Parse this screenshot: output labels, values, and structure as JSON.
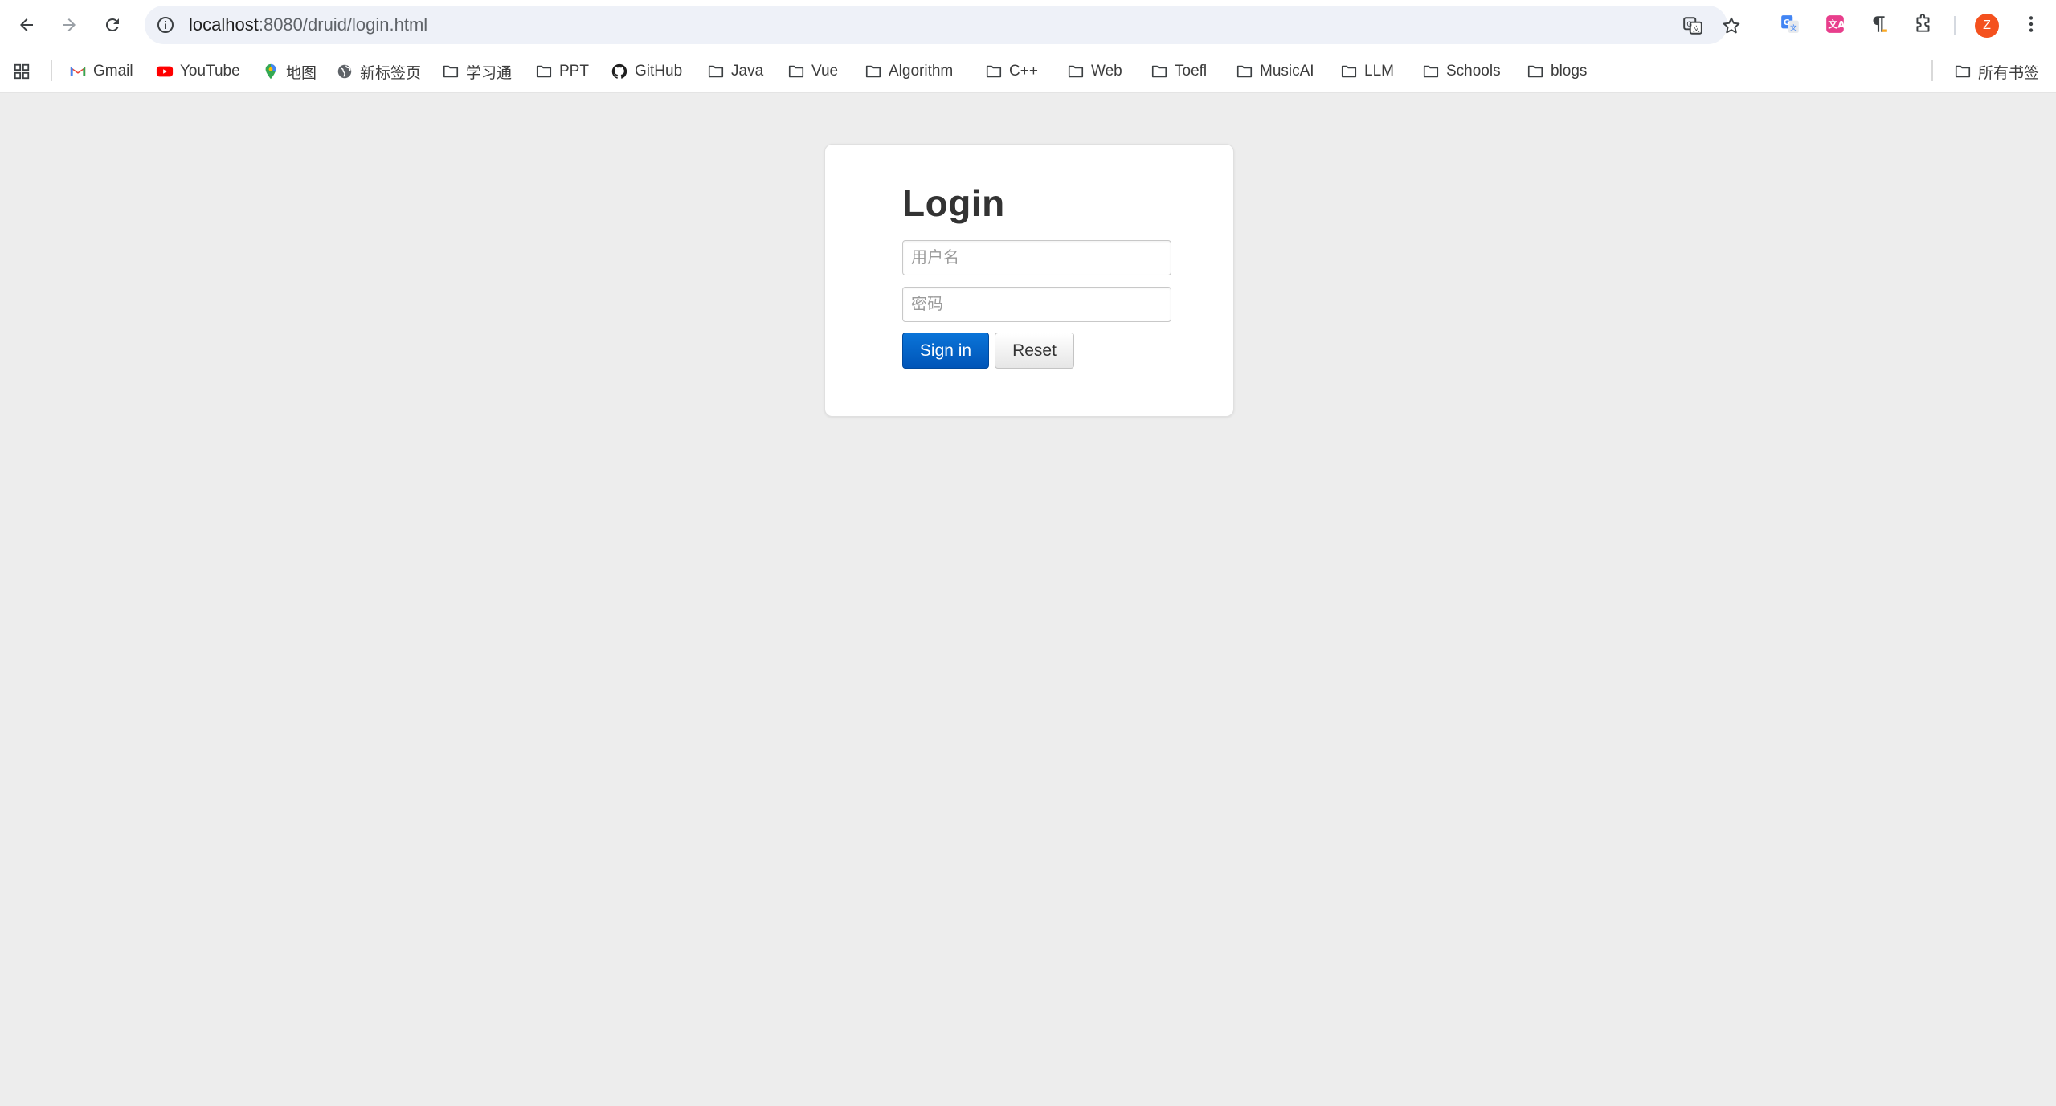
{
  "browser": {
    "url_host": "localhost",
    "url_rest": ":8080/druid/login.html",
    "avatar_letter": "Z",
    "accent_color": "#f4511e"
  },
  "bookmarks": [
    {
      "label": "Gmail",
      "icon": "gmail-icon"
    },
    {
      "label": "YouTube",
      "icon": "youtube-icon"
    },
    {
      "label": "地图",
      "icon": "maps-icon"
    },
    {
      "label": "新标签页",
      "icon": "globe-icon"
    },
    {
      "label": "学习通",
      "icon": "folder-icon"
    },
    {
      "label": "PPT",
      "icon": "folder-icon"
    },
    {
      "label": "GitHub",
      "icon": "github-icon"
    },
    {
      "label": "Java",
      "icon": "folder-icon"
    },
    {
      "label": "Vue",
      "icon": "folder-icon"
    },
    {
      "label": "Algorithm",
      "icon": "folder-icon"
    },
    {
      "label": "C++",
      "icon": "folder-icon"
    },
    {
      "label": "Web",
      "icon": "folder-icon"
    },
    {
      "label": "Toefl",
      "icon": "folder-icon"
    },
    {
      "label": "MusicAI",
      "icon": "folder-icon"
    },
    {
      "label": "LLM",
      "icon": "folder-icon"
    },
    {
      "label": "Schools",
      "icon": "folder-icon"
    },
    {
      "label": "blogs",
      "icon": "folder-icon"
    }
  ],
  "all_bookmarks_label": "所有书签",
  "login": {
    "title": "Login",
    "username_placeholder": "用户名",
    "password_placeholder": "密码",
    "signin_label": "Sign in",
    "reset_label": "Reset",
    "primary_color": "#0062c8"
  }
}
